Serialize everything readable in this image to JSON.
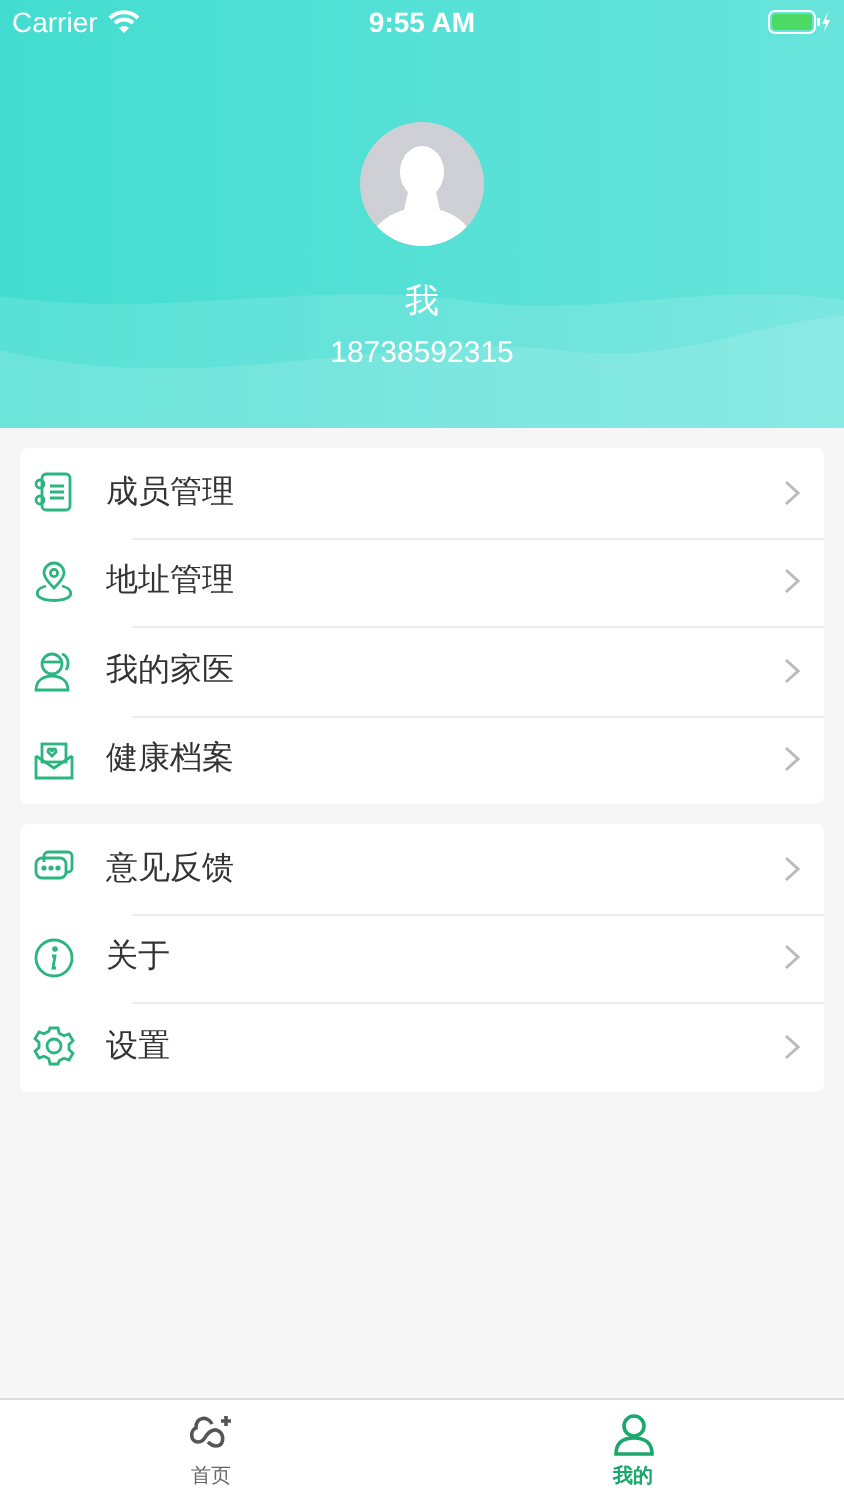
{
  "status_bar": {
    "carrier": "Carrier",
    "time": "9:55 AM"
  },
  "profile": {
    "name": "我",
    "phone": "18738592315"
  },
  "menu_groups": [
    {
      "items": [
        {
          "label": "成员管理",
          "kind": "members"
        },
        {
          "label": "地址管理",
          "kind": "address"
        },
        {
          "label": "我的家医",
          "kind": "doctor"
        },
        {
          "label": "健康档案",
          "kind": "records"
        }
      ]
    },
    {
      "items": [
        {
          "label": "意见反馈",
          "kind": "feedback"
        },
        {
          "label": "关于",
          "kind": "about"
        },
        {
          "label": "设置",
          "kind": "settings"
        }
      ]
    }
  ],
  "tab_bar": [
    {
      "label": "首页",
      "kind": "home",
      "selected": false
    },
    {
      "label": "我的",
      "kind": "profile",
      "selected": true
    }
  ]
}
